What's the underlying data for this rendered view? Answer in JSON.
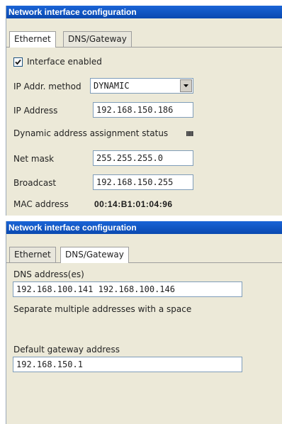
{
  "panel1": {
    "title": "Network interface configuration",
    "tabs": [
      "Ethernet",
      "DNS/Gateway"
    ],
    "active_tab": "Ethernet",
    "interface_enabled": {
      "label": "Interface enabled",
      "checked": true
    },
    "ip_method": {
      "label": "IP Addr. method",
      "value": "DYNAMIC"
    },
    "ip_address": {
      "label": "IP Address",
      "value": "192.168.150.186"
    },
    "dynamic_status": {
      "label": "Dynamic address assignment status"
    },
    "net_mask": {
      "label": "Net mask",
      "value": "255.255.255.0"
    },
    "broadcast": {
      "label": "Broadcast",
      "value": "192.168.150.255"
    },
    "mac": {
      "label": "MAC address",
      "value": "00:14:B1:01:04:96"
    }
  },
  "panel2": {
    "title": "Network interface configuration",
    "tabs": [
      "Ethernet",
      "DNS/Gateway"
    ],
    "active_tab": "DNS/Gateway",
    "dns": {
      "label": "DNS address(es)",
      "value": "192.168.100.141 192.168.100.146"
    },
    "dns_hint": "Separate multiple addresses with a space",
    "gateway": {
      "label": "Default gateway address",
      "value": "192.168.150.1"
    }
  }
}
